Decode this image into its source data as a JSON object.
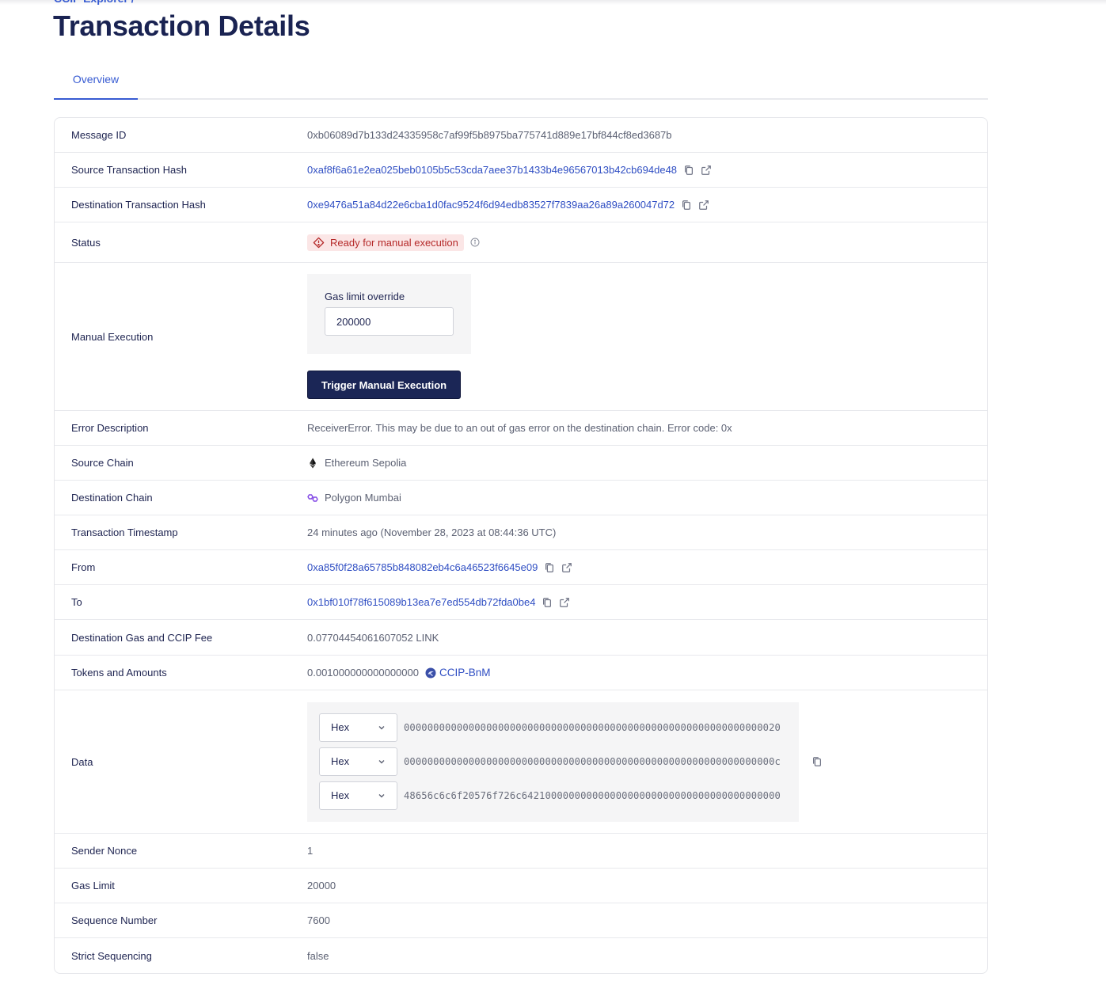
{
  "breadcrumb": "CCIP Explorer /",
  "page_title": "Transaction Details",
  "tabs": [
    {
      "label": "Overview",
      "active": true
    }
  ],
  "colors": {
    "accent": "#375bd2",
    "title": "#1a2352",
    "button_bg": "#1b2656",
    "status_bg": "#fbe6e6",
    "status_fg": "#b52a2a",
    "polygon": "#8247e5"
  },
  "details": {
    "message_id": {
      "label": "Message ID",
      "value": "0xb06089d7b133d24335958c7af99f5b8975ba775741d889e17bf844cf8ed3687b"
    },
    "source_tx": {
      "label": "Source Transaction Hash",
      "value": "0xaf8f6a61e2ea025beb0105b5c53cda7aee37b1433b4e96567013b42cb694de48",
      "icons": [
        "copy-icon",
        "external-link-icon"
      ]
    },
    "dest_tx": {
      "label": "Destination Transaction Hash",
      "value": "0xe9476a51a84d22e6cba1d0fac9524f6d94edb83527f7839aa26a89a260047d72",
      "icons": [
        "copy-icon",
        "external-link-icon"
      ]
    },
    "status": {
      "label": "Status",
      "value": "Ready for manual execution",
      "icon": "warning-diamond-icon",
      "info_icon": "info-icon"
    },
    "manual_execution": {
      "label": "Manual Execution",
      "gas_limit_label": "Gas limit override",
      "gas_limit_value": "200000",
      "button_label": "Trigger Manual Execution"
    },
    "error_description": {
      "label": "Error Description",
      "value": "ReceiverError. This may be due to an out of gas error on the destination chain. Error code: 0x"
    },
    "source_chain": {
      "label": "Source Chain",
      "value": "Ethereum Sepolia",
      "icon": "ethereum-icon"
    },
    "destination_chain": {
      "label": "Destination Chain",
      "value": "Polygon Mumbai",
      "icon": "polygon-icon"
    },
    "timestamp": {
      "label": "Transaction Timestamp",
      "value": "24 minutes ago (November 28, 2023 at 08:44:36 UTC)"
    },
    "from": {
      "label": "From",
      "value": "0xa85f0f28a65785b848082eb4c6a46523f6645e09",
      "icons": [
        "copy-icon",
        "external-link-icon"
      ]
    },
    "to": {
      "label": "To",
      "value": "0x1bf010f78f615089b13ea7e7ed554db72fda0be4",
      "icons": [
        "copy-icon",
        "external-link-icon"
      ]
    },
    "fee": {
      "label": "Destination Gas and CCIP Fee",
      "value": "0.07704454061607052 LINK"
    },
    "tokens": {
      "label": "Tokens and Amounts",
      "amount": "0.001000000000000000",
      "token": "CCIP-BnM",
      "icon": "ccip-bnm-token-icon"
    },
    "data": {
      "label": "Data",
      "lines": [
        {
          "format": "Hex",
          "value": "0000000000000000000000000000000000000000000000000000000000000020"
        },
        {
          "format": "Hex",
          "value": "000000000000000000000000000000000000000000000000000000000000000c"
        },
        {
          "format": "Hex",
          "value": "48656c6c6f20576f726c64210000000000000000000000000000000000000000"
        }
      ]
    },
    "sender_nonce": {
      "label": "Sender Nonce",
      "value": "1"
    },
    "gas_limit": {
      "label": "Gas Limit",
      "value": "20000"
    },
    "sequence_number": {
      "label": "Sequence Number",
      "value": "7600"
    },
    "strict_sequencing": {
      "label": "Strict Sequencing",
      "value": "false"
    }
  }
}
